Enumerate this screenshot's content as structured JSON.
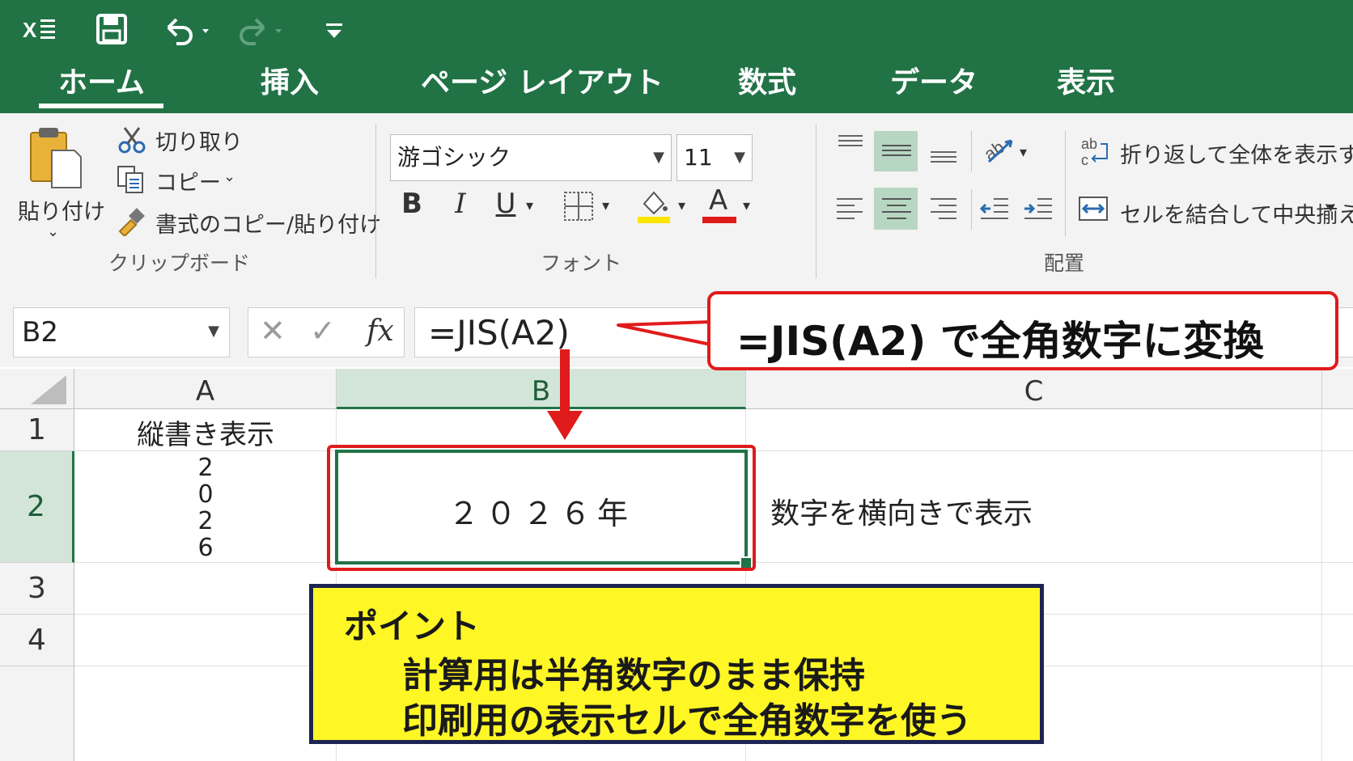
{
  "titlebar": {
    "qa_icons": [
      "excel-logo-icon",
      "save-icon",
      "undo-icon",
      "redo-icon",
      "customize-quick-access-icon"
    ],
    "tabs": [
      {
        "label": "ホーム",
        "active": true
      },
      {
        "label": "挿入"
      },
      {
        "label": "ページ レイアウト"
      },
      {
        "label": "数式"
      },
      {
        "label": "データ"
      },
      {
        "label": "表示"
      }
    ]
  },
  "ribbon": {
    "clipboard": {
      "paste_label": "貼り付け",
      "cut_label": "切り取り",
      "copy_label": "コピー",
      "format_painter_label": "書式のコピー/貼り付け",
      "group_label": "クリップボード"
    },
    "font": {
      "font_name": "游ゴシック",
      "font_size": "11",
      "bold": "B",
      "italic": "I",
      "underline": "U",
      "font_color_letter": "A",
      "group_label": "フォント",
      "highlight_color": "#ffe600",
      "font_color": "#e01b1b"
    },
    "alignment": {
      "wrap_label": "折り返して全体を表示する",
      "wrap_icon_text": "ab",
      "merge_label": "セルを結合して中央揃え",
      "group_label": "配置"
    }
  },
  "formula_bar": {
    "name_box": "B2",
    "fx": "fx",
    "formula": "=JIS(A2)"
  },
  "grid": {
    "columns": [
      "A",
      "B",
      "C"
    ],
    "rows": [
      "1",
      "2",
      "3",
      "4"
    ],
    "cells": {
      "A1": "縦書き表示",
      "A2": [
        "2",
        "0",
        "2",
        "6"
      ],
      "B2": "２０２６年",
      "C2": "数字を横向きで表示"
    }
  },
  "annotations": {
    "formula_callout": "=JIS(A2) で全角数字に変換",
    "point_title": "ポイント",
    "point_line1": "計算用は半角数字のまま保持",
    "point_line2": "印刷用の表示セルで全角数字を使う"
  },
  "colors": {
    "excel_green": "#217346",
    "callout_red": "#e01b1b",
    "point_yellow": "#fff725",
    "point_border": "#1d2452",
    "selected_header": "#b7d7c3"
  }
}
